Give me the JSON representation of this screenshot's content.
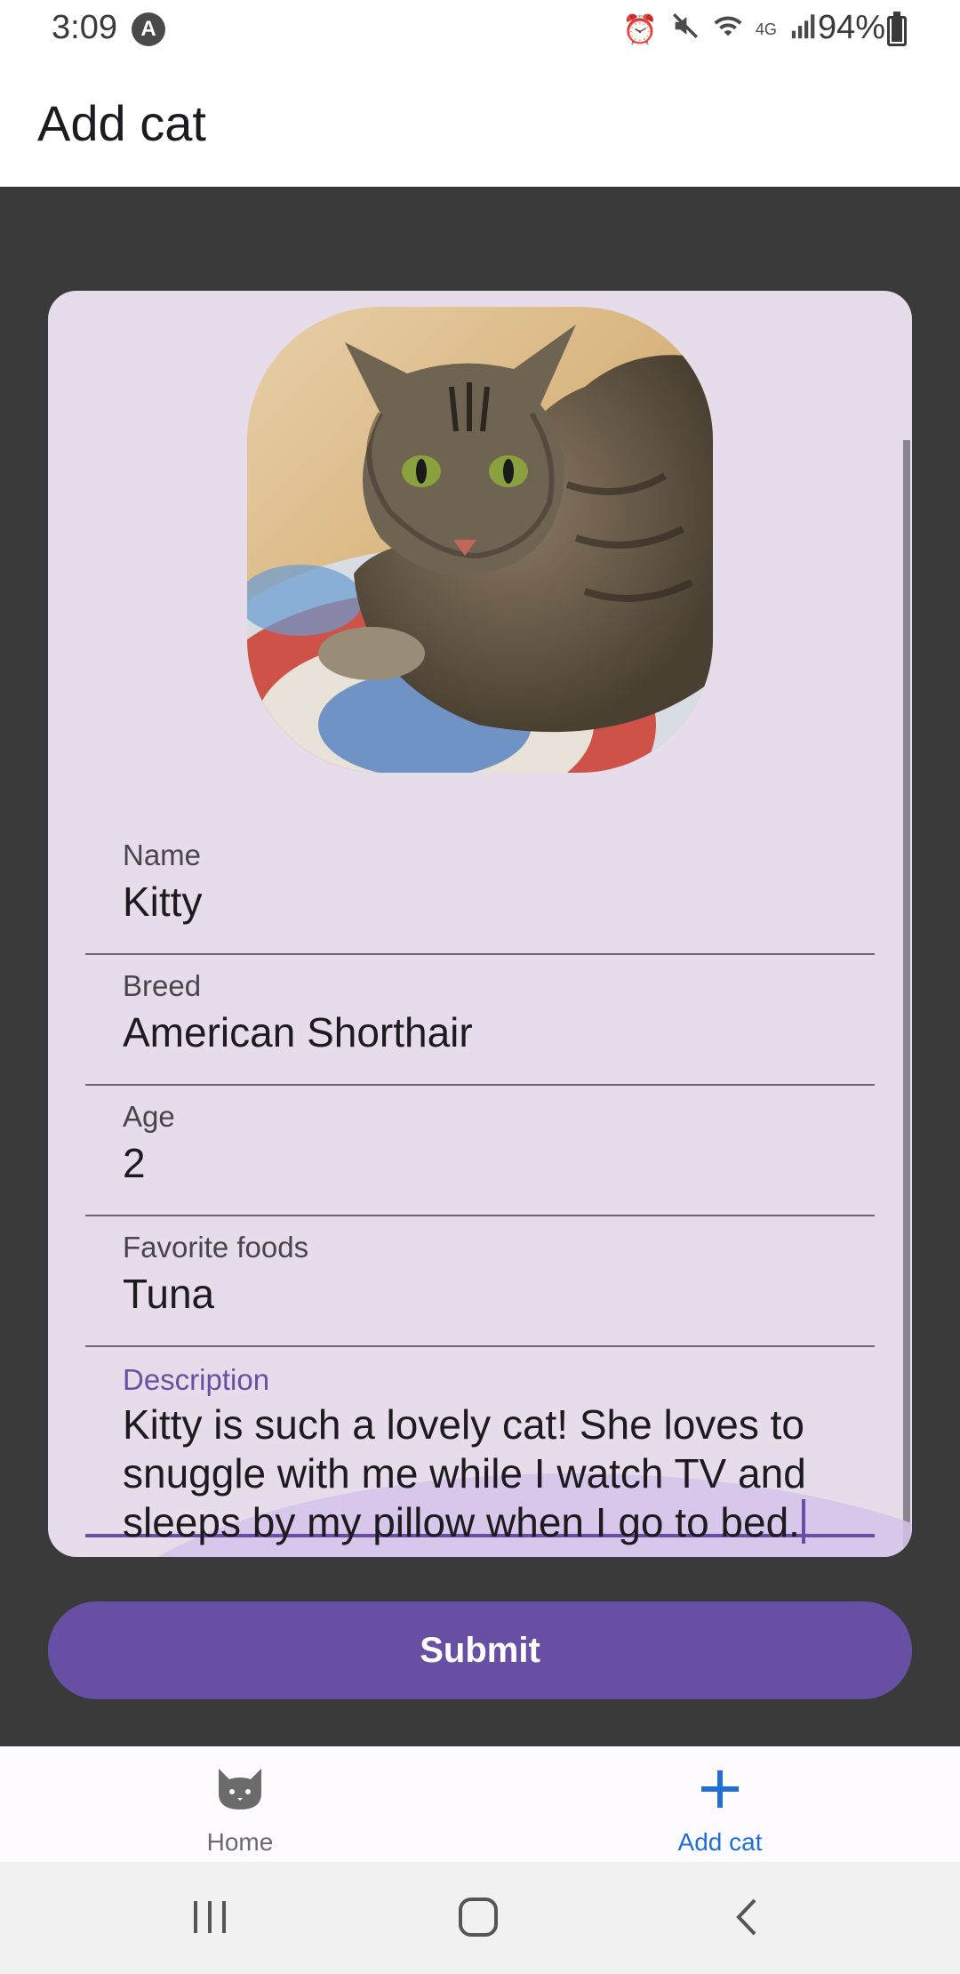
{
  "status_bar": {
    "time": "3:09",
    "notification_badge": "A",
    "battery": "94%",
    "battery_level": 0.94,
    "icons": [
      "alarm-icon",
      "mute-icon",
      "wifi-icon",
      "lte-icon",
      "signal-icon",
      "battery-icon"
    ]
  },
  "app_bar": {
    "title": "Add cat"
  },
  "form": {
    "fields": [
      {
        "label": "Name",
        "value": "Kitty"
      },
      {
        "label": "Breed",
        "value": "American Shorthair"
      },
      {
        "label": "Age",
        "value": "2"
      },
      {
        "label": "Favorite foods",
        "value": "Tuna"
      }
    ],
    "description": {
      "label": "Description",
      "value": "Kitty is such a lovely cat! She loves to snuggle with me while I watch TV and sleeps by my pillow when I go to bed."
    },
    "submit_label": "Submit"
  },
  "bottom_nav": {
    "items": [
      {
        "label": "Home",
        "icon": "cat-icon",
        "selected": false
      },
      {
        "label": "Add cat",
        "icon": "plus-icon",
        "selected": true
      }
    ]
  },
  "colors": {
    "primary": "#6750a4",
    "card": "#e6dcea",
    "background": "#3a3a3a",
    "nav_selected": "#1f6fd6"
  }
}
